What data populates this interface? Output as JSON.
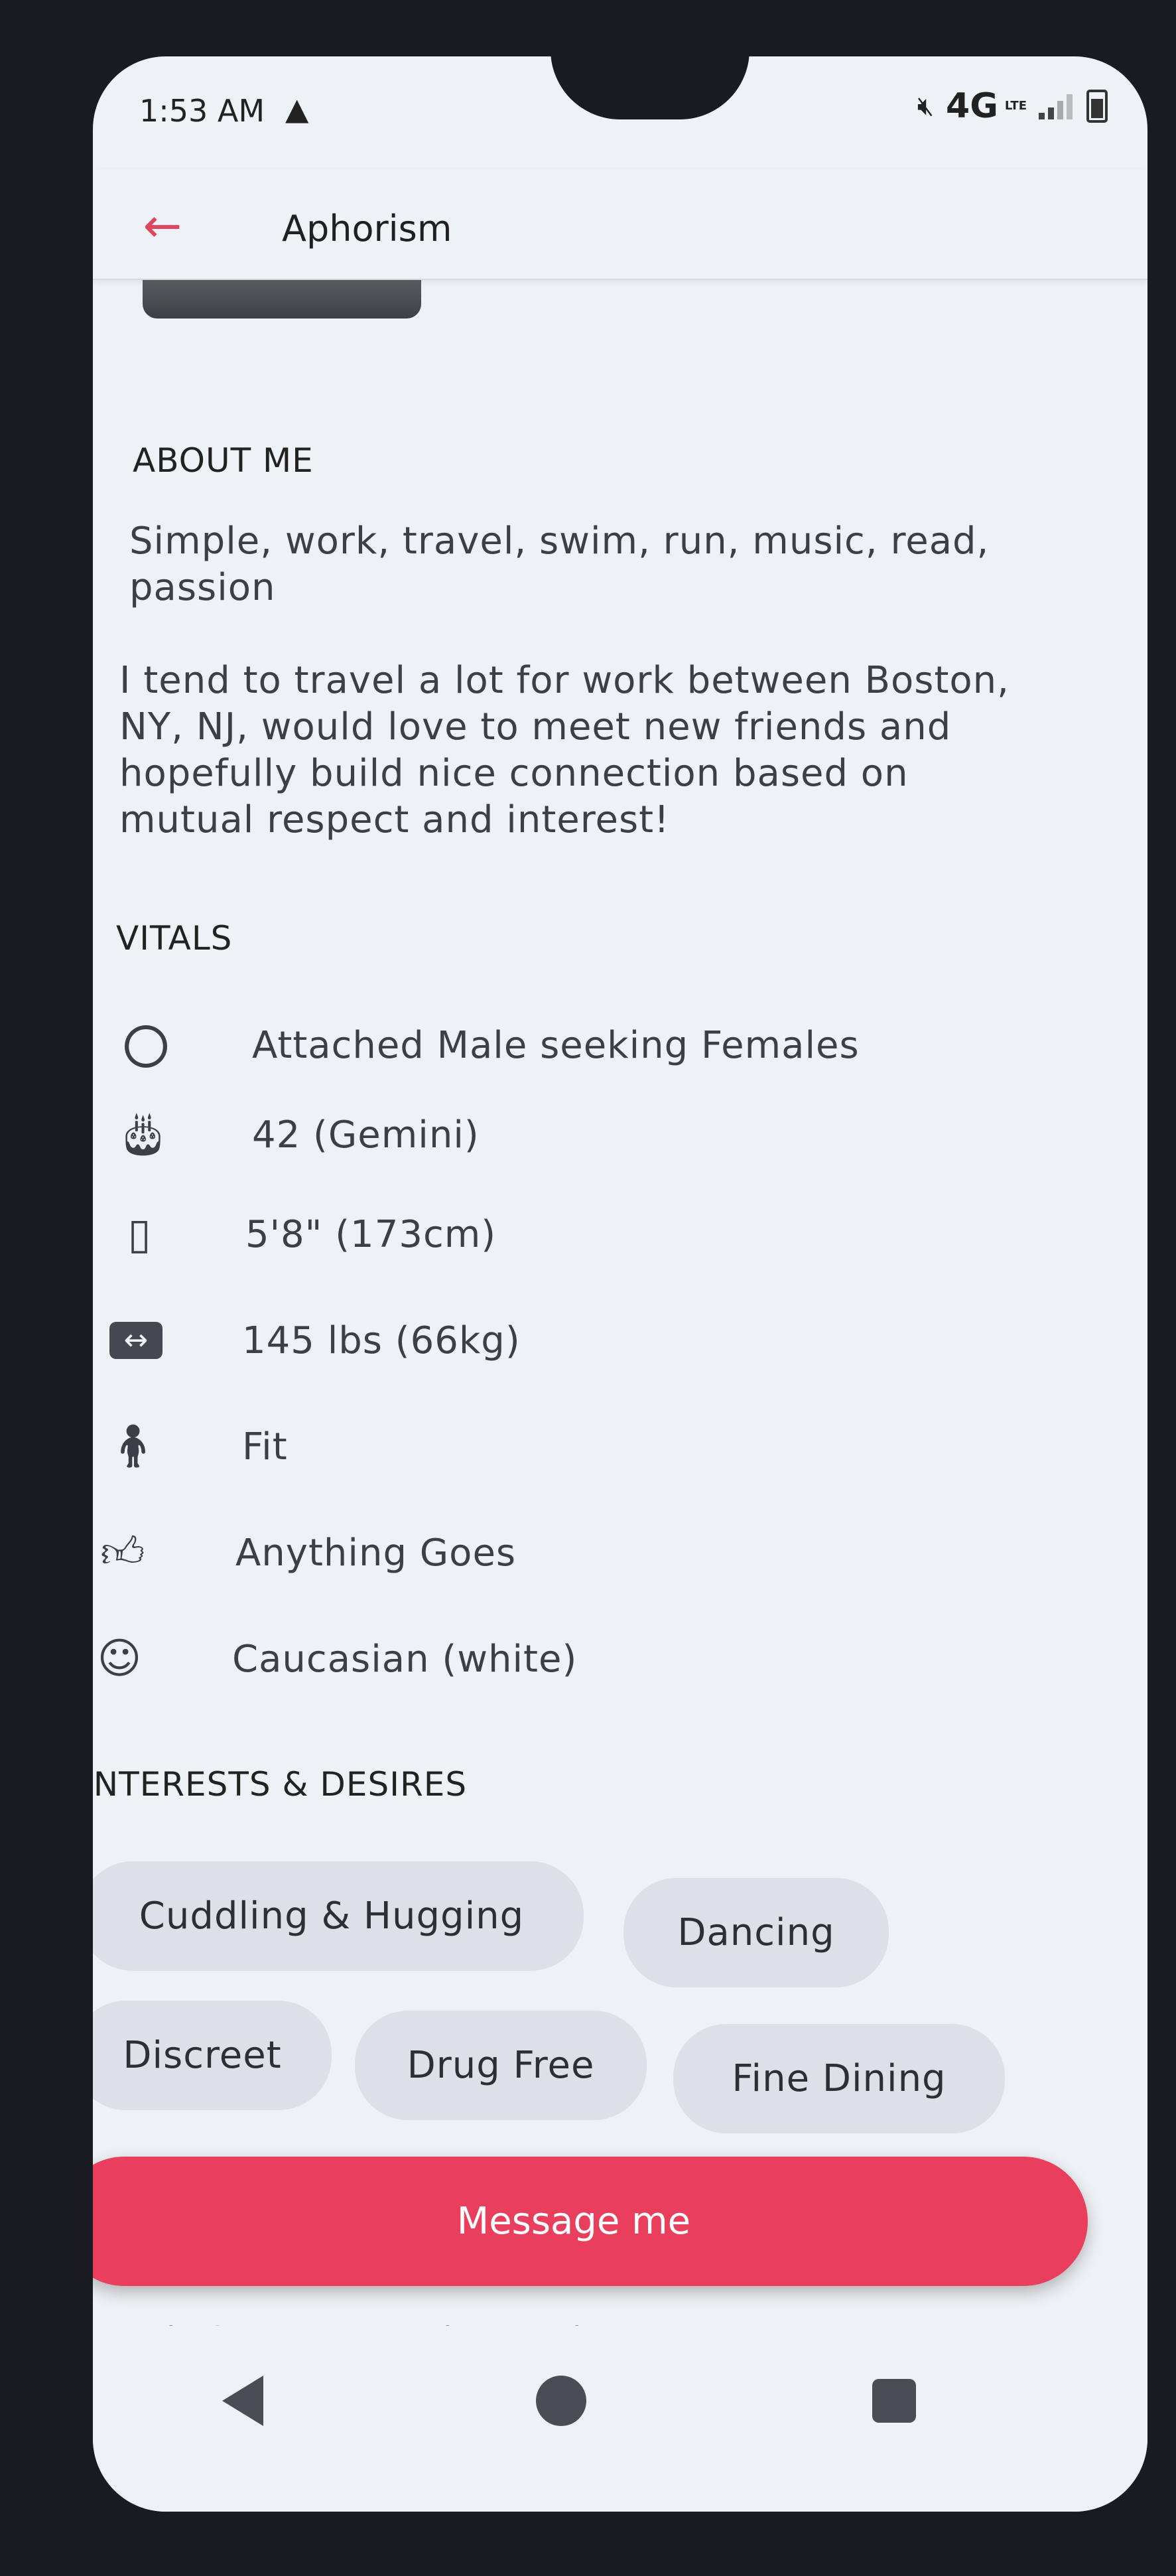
{
  "status_bar": {
    "time": "1:53 AM",
    "alert_icon": "warning-triangle-icon",
    "network": "4G",
    "network_sub": "LTE",
    "icons": [
      "mute-icon",
      "signal-icon",
      "battery-icon"
    ]
  },
  "app_bar": {
    "back_icon": "arrow-left-icon",
    "title": "Aphorism",
    "accent_color": "#e0455f"
  },
  "about": {
    "heading": "ABOUT ME",
    "line1": "Simple, work, travel, swim, run, music, read,",
    "line2": "passion",
    "para_lines": [
      "I tend to travel a lot for work between Boston,",
      "NY, NJ, would love to meet new friends and",
      "hopefully build nice connection based on",
      "mutual respect and interest!"
    ]
  },
  "vitals": {
    "heading": "VITALS",
    "items": [
      {
        "icon": "ring-icon",
        "label": "Attached Male seeking Females"
      },
      {
        "icon": "cake-icon",
        "label": "42 (Gemini)"
      },
      {
        "icon": "ruler-icon",
        "label": "5'8\" (173cm)"
      },
      {
        "icon": "width-arrows-icon",
        "label": "145 lbs (66kg)"
      },
      {
        "icon": "person-icon",
        "label": "Fit"
      },
      {
        "icon": "thumbs-up-icon",
        "label": "Anything Goes"
      },
      {
        "icon": "face-icon",
        "label": "Caucasian (white)"
      }
    ]
  },
  "interests": {
    "heading": "INTERESTS & DESIRES",
    "chips": [
      "Cuddling & Hugging",
      "Dancing",
      "Discreet",
      "Drug Free",
      "Fine Dining"
    ]
  },
  "cta": {
    "label": "Message me",
    "color": "#e93f5c"
  },
  "partial_row": "Music    Open to Experimentation",
  "nav": {
    "icons": [
      "back-triangle-icon",
      "home-circle-icon",
      "recents-square-icon"
    ]
  }
}
